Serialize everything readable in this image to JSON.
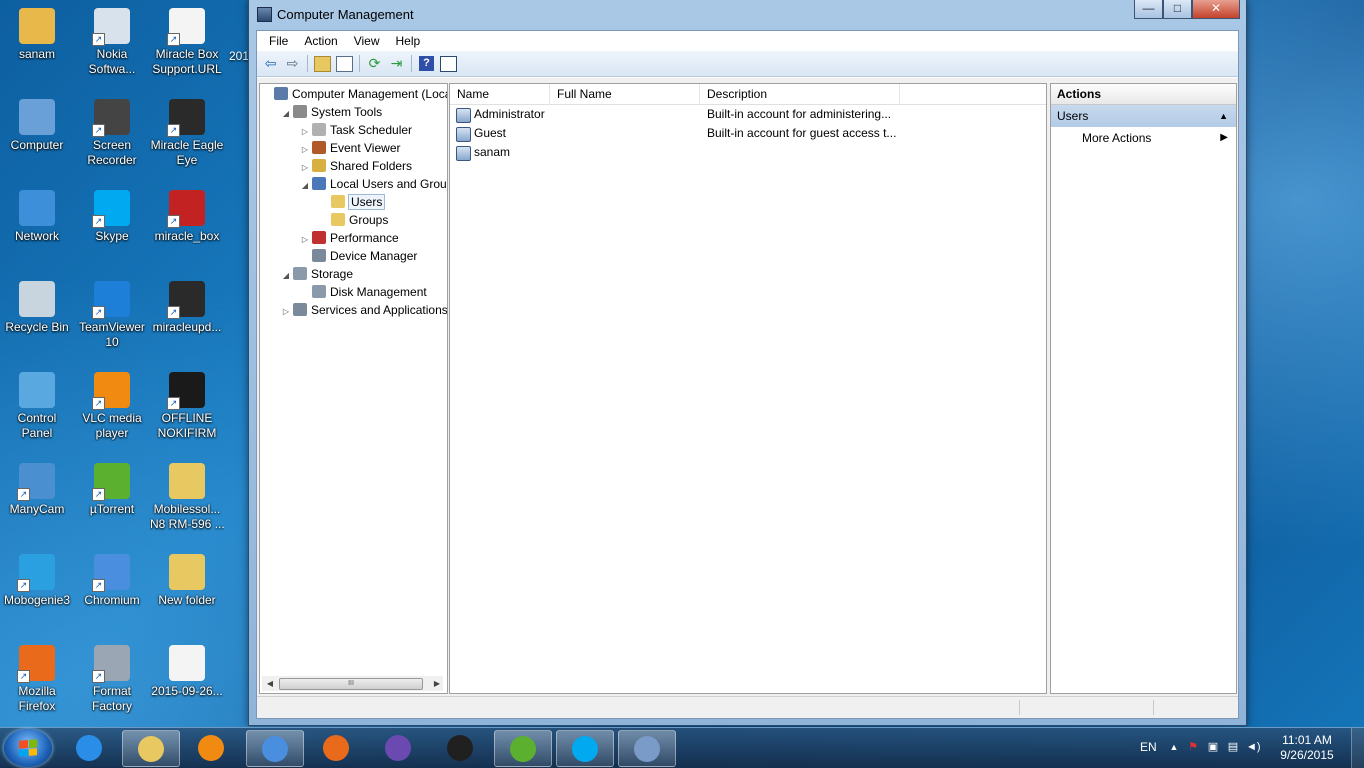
{
  "desktop": {
    "icons": [
      {
        "label": "sanam",
        "label2": "",
        "color": "#e8b84a",
        "shortcut": false
      },
      {
        "label": "Nokia",
        "label2": "Softwa...",
        "color": "#d8e2ec",
        "shortcut": true
      },
      {
        "label": "Miracle Box",
        "label2": "Support.URL",
        "color": "#f4f4f4",
        "shortcut": true
      },
      {
        "label": "Computer",
        "label2": "",
        "color": "#6aa0d8",
        "shortcut": false
      },
      {
        "label": "Screen",
        "label2": "Recorder",
        "color": "#444444",
        "shortcut": true
      },
      {
        "label": "Miracle Eagle",
        "label2": "Eye",
        "color": "#2a2a2a",
        "shortcut": true
      },
      {
        "label": "Network",
        "label2": "",
        "color": "#3c8fd8",
        "shortcut": false
      },
      {
        "label": "Skype",
        "label2": "",
        "color": "#00a9f0",
        "shortcut": true
      },
      {
        "label": "miracle_box",
        "label2": "",
        "color": "#c22222",
        "shortcut": true
      },
      {
        "label": "Recycle Bin",
        "label2": "",
        "color": "#c8d4de",
        "shortcut": false
      },
      {
        "label": "TeamViewer",
        "label2": "10",
        "color": "#1e7fd8",
        "shortcut": true
      },
      {
        "label": "miracleupd...",
        "label2": "",
        "color": "#2a2a2a",
        "shortcut": true
      },
      {
        "label": "Control",
        "label2": "Panel",
        "color": "#5aa8e0",
        "shortcut": false
      },
      {
        "label": "VLC media",
        "label2": "player",
        "color": "#f08a10",
        "shortcut": true
      },
      {
        "label": "OFFLINE",
        "label2": "NOKIFIRM",
        "color": "#1a1a1a",
        "shortcut": true
      },
      {
        "label": "ManyCam",
        "label2": "",
        "color": "#4a90d0",
        "shortcut": true
      },
      {
        "label": "µTorrent",
        "label2": "",
        "color": "#5cb030",
        "shortcut": true
      },
      {
        "label": "Mobilessol...",
        "label2": "N8 RM-596 ...",
        "color": "#e8c860",
        "shortcut": false
      },
      {
        "label": "Mobogenie3",
        "label2": "",
        "color": "#2aa0e0",
        "shortcut": true
      },
      {
        "label": "Chromium",
        "label2": "",
        "color": "#4a8ee0",
        "shortcut": true
      },
      {
        "label": "New folder",
        "label2": "",
        "color": "#e8c860",
        "shortcut": false
      },
      {
        "label": "Mozilla",
        "label2": "Firefox",
        "color": "#e86a1a",
        "shortcut": true
      },
      {
        "label": "Format",
        "label2": "Factory",
        "color": "#9aa6b4",
        "shortcut": true
      },
      {
        "label": "2015-09-26...",
        "label2": "",
        "color": "#f4f4f4",
        "shortcut": false
      }
    ],
    "partial_label": "201"
  },
  "window": {
    "title": "Computer Management",
    "buttons": {
      "minimize": "—",
      "maximize": "□",
      "close": "✕"
    },
    "menu": [
      "File",
      "Action",
      "View",
      "Help"
    ],
    "tree": [
      {
        "label": "Computer Management (Local",
        "expander": "",
        "icon_color": "#5a7aa8"
      },
      {
        "label": "System Tools",
        "expander": "◢",
        "icon_color": "#8a8a8a"
      },
      {
        "label": "Task Scheduler",
        "expander": "▷",
        "icon_color": "#b0b0b0"
      },
      {
        "label": "Event Viewer",
        "expander": "▷",
        "icon_color": "#b05a2a"
      },
      {
        "label": "Shared Folders",
        "expander": "▷",
        "icon_color": "#d8b040"
      },
      {
        "label": "Local Users and Groups",
        "expander": "◢",
        "icon_color": "#4a78b8"
      },
      {
        "label": "Users",
        "expander": "",
        "icon_color": "#e8c860"
      },
      {
        "label": "Groups",
        "expander": "",
        "icon_color": "#e8c860"
      },
      {
        "label": "Performance",
        "expander": "▷",
        "icon_color": "#c03030"
      },
      {
        "label": "Device Manager",
        "expander": "",
        "icon_color": "#7a8a9a"
      },
      {
        "label": "Storage",
        "expander": "◢",
        "icon_color": "#8a9aaa"
      },
      {
        "label": "Disk Management",
        "expander": "",
        "icon_color": "#8a9aaa"
      },
      {
        "label": "Services and Applications",
        "expander": "▷",
        "icon_color": "#7a8a9a"
      }
    ],
    "scroll_thumb": "III",
    "columns": [
      "Name",
      "Full Name",
      "Description"
    ],
    "users": [
      {
        "name": "Administrator",
        "full_name": "",
        "description": "Built-in account for administering..."
      },
      {
        "name": "Guest",
        "full_name": "",
        "description": "Built-in account for guest access t..."
      },
      {
        "name": "sanam",
        "full_name": "",
        "description": ""
      }
    ],
    "actions": {
      "header": "Actions",
      "section": "Users",
      "items": [
        "More Actions"
      ]
    }
  },
  "taskbar": {
    "apps": [
      {
        "name": "ie",
        "color": "#2a8ee8",
        "active": false
      },
      {
        "name": "explorer",
        "color": "#e8c860",
        "active": true
      },
      {
        "name": "media-player",
        "color": "#f08a10",
        "active": false
      },
      {
        "name": "chromium",
        "color": "#4a8ee0",
        "active": true
      },
      {
        "name": "firefox",
        "color": "#e86a1a",
        "active": false
      },
      {
        "name": "app",
        "color": "#6a4ab0",
        "active": false
      },
      {
        "name": "app-grid",
        "color": "#202020",
        "active": false
      },
      {
        "name": "utorrent",
        "color": "#5cb030",
        "active": true
      },
      {
        "name": "skype",
        "color": "#00a9f0",
        "active": true
      },
      {
        "name": "computer-management",
        "color": "#7a9ac8",
        "active": true
      }
    ],
    "language": "EN",
    "time": "11:01 AM",
    "date": "9/26/2015"
  }
}
